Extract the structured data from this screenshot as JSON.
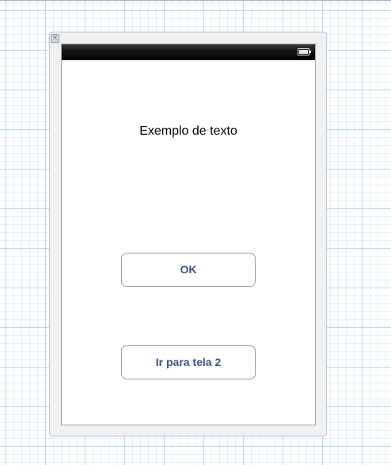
{
  "scene": {
    "label_text": "Exemplo de texto",
    "ok_button_label": "OK",
    "next_screen_button_label": "Ir para tela 2"
  },
  "status_bar": {
    "battery_icon": "battery-full-icon"
  },
  "canvas": {
    "close_icon": "close-icon"
  },
  "colors": {
    "button_text": "#385487",
    "grid_line": "#b9d9e6",
    "status_bar": "#000000"
  }
}
